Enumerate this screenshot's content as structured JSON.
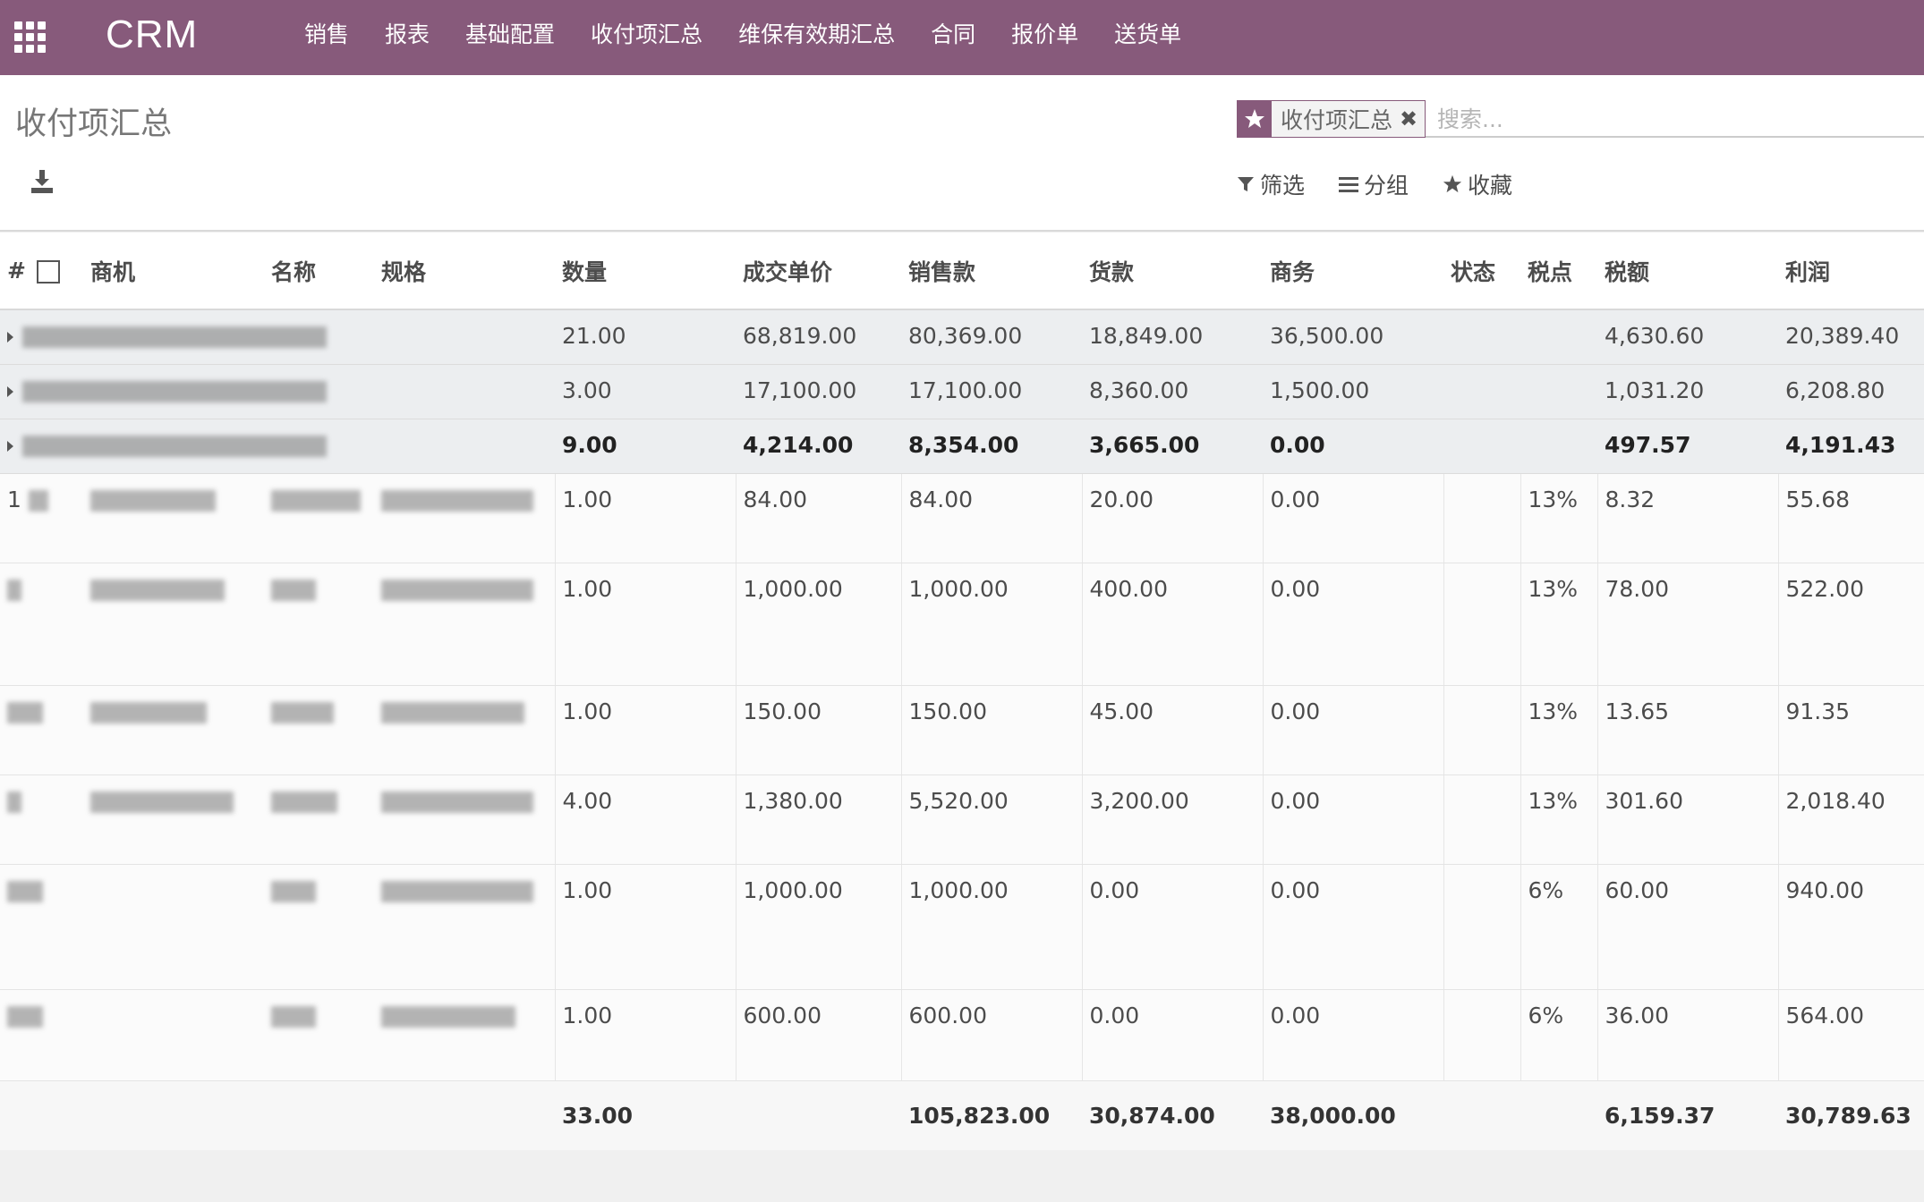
{
  "nav": {
    "brand": "CRM",
    "menu": [
      "销售",
      "报表",
      "基础配置",
      "收付项汇总",
      "维保有效期汇总",
      "合同",
      "报价单",
      "送货单"
    ]
  },
  "page": {
    "title": "收付项汇总"
  },
  "search": {
    "facet": "收付项汇总",
    "facet_close": "✖",
    "placeholder": "搜索..."
  },
  "filters": {
    "filter": "筛选",
    "group": "分组",
    "favorites": "收藏"
  },
  "columns": [
    "#",
    "商机",
    "名称",
    "规格",
    "数量",
    "成交单价",
    "销售款",
    "货款",
    "商务",
    "状态",
    "税点",
    "税额",
    "利润"
  ],
  "groups": [
    {
      "qty": "21.00",
      "price": "68,819.00",
      "sales": "80,369.00",
      "goods": "18,849.00",
      "biz": "36,500.00",
      "tax": "4,630.60",
      "profit": "20,389.40"
    },
    {
      "qty": "3.00",
      "price": "17,100.00",
      "sales": "17,100.00",
      "goods": "8,360.00",
      "biz": "1,500.00",
      "tax": "1,031.20",
      "profit": "6,208.80"
    },
    {
      "qty": "9.00",
      "price": "4,214.00",
      "sales": "8,354.00",
      "goods": "3,665.00",
      "biz": "0.00",
      "tax": "497.57",
      "profit": "4,191.43"
    }
  ],
  "rows": [
    {
      "num": "1",
      "qty": "1.00",
      "price": "84.00",
      "sales": "84.00",
      "goods": "20.00",
      "biz": "0.00",
      "rate": "13%",
      "tax": "8.32",
      "profit": "55.68"
    },
    {
      "num": "",
      "qty": "1.00",
      "price": "1,000.00",
      "sales": "1,000.00",
      "goods": "400.00",
      "biz": "0.00",
      "rate": "13%",
      "tax": "78.00",
      "profit": "522.00"
    },
    {
      "num": "",
      "qty": "1.00",
      "price": "150.00",
      "sales": "150.00",
      "goods": "45.00",
      "biz": "0.00",
      "rate": "13%",
      "tax": "13.65",
      "profit": "91.35"
    },
    {
      "num": "",
      "qty": "4.00",
      "price": "1,380.00",
      "sales": "5,520.00",
      "goods": "3,200.00",
      "biz": "0.00",
      "rate": "13%",
      "tax": "301.60",
      "profit": "2,018.40"
    },
    {
      "num": "",
      "qty": "1.00",
      "price": "1,000.00",
      "sales": "1,000.00",
      "goods": "0.00",
      "biz": "0.00",
      "rate": "6%",
      "tax": "60.00",
      "profit": "940.00"
    },
    {
      "num": "",
      "qty": "1.00",
      "price": "600.00",
      "sales": "600.00",
      "goods": "0.00",
      "biz": "0.00",
      "rate": "6%",
      "tax": "36.00",
      "profit": "564.00"
    }
  ],
  "totals": {
    "qty": "33.00",
    "sales": "105,823.00",
    "goods": "30,874.00",
    "biz": "38,000.00",
    "tax": "6,159.37",
    "profit": "30,789.63"
  },
  "colors": {
    "navbar": "#875a7b",
    "group_row": "#eceef0"
  }
}
